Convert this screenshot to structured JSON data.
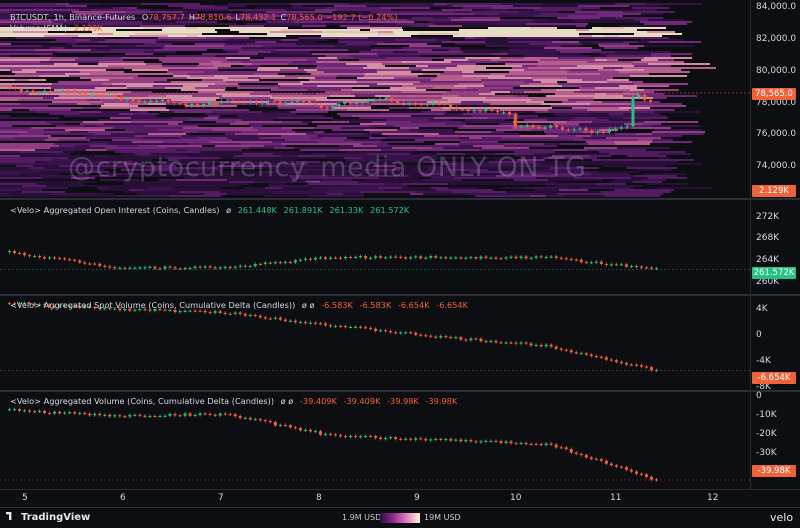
{
  "header": {
    "symbol": "BTCUSDT, 1h, Binance-Futures",
    "ohlc": [
      {
        "k": "O",
        "v": "78,757.7"
      },
      {
        "k": "H",
        "v": "78,810.6"
      },
      {
        "k": "L",
        "v": "78,432.1"
      },
      {
        "k": "C",
        "v": "78,565.0"
      }
    ],
    "change": "−192.7 (−0.24%)",
    "volume_label": "Volume (SMA)",
    "volume_value": "2.129K"
  },
  "watermark": "@cryptocurrency_media ONLY ON TG",
  "price_axis": {
    "ticks": [
      "84,000.0",
      "82,000.0",
      "80,000.0",
      "78,000.0",
      "76,000.0",
      "74,000.0"
    ],
    "current_price": "78,565.0",
    "volume_tag": "2.129K",
    "current_color": "#f0623a"
  },
  "panes": [
    {
      "title": "<Velo> Aggregated Open Interest (Coins, Candles)",
      "symbol": "ø",
      "values": [
        {
          "v": "261.448K",
          "c": "g"
        },
        {
          "v": "261.891K",
          "c": "g"
        },
        {
          "v": "261.33K",
          "c": "g"
        },
        {
          "v": "261.572K",
          "c": "g"
        }
      ],
      "ticks": [
        "272K",
        "268K",
        "264K",
        "260K"
      ],
      "tag": "261.572K",
      "tag_color": "#26c281"
    },
    {
      "title": "<Velo> Aggregated Spot Volume (Coins, Cumulative Delta (Candles))",
      "symbol": "ø ø",
      "values": [
        {
          "v": "-6.583K",
          "c": "r"
        },
        {
          "v": "-6.583K",
          "c": "r"
        },
        {
          "v": "-6.654K",
          "c": "r"
        },
        {
          "v": "-6.654K",
          "c": "r"
        }
      ],
      "ticks": [
        "4K",
        "0",
        "-4K",
        "-8K"
      ],
      "tag": "-6.654K",
      "tag_color": "#f0623a"
    },
    {
      "title": "<Velo> Aggregated Volume (Coins, Cumulative Delta (Candles))",
      "symbol": "ø ø",
      "values": [
        {
          "v": "-39.409K",
          "c": "r"
        },
        {
          "v": "-39.409K",
          "c": "r"
        },
        {
          "v": "-39.98K",
          "c": "r"
        },
        {
          "v": "-39.98K",
          "c": "r"
        }
      ],
      "ticks": [
        "0",
        "-10K",
        "-20K",
        "-30K",
        "-40K"
      ],
      "tag": "-39.98K",
      "tag_color": "#f0623a"
    }
  ],
  "x_axis": [
    "5",
    "6",
    "7",
    "8",
    "9",
    "10",
    "11",
    "12"
  ],
  "footer": {
    "brand": "TradingView",
    "gradient_min": "1.9M USD",
    "gradient_max": "19M USD",
    "velo": "velo"
  },
  "colors": {
    "up": "#26c281",
    "down": "#f0623a",
    "heat_low": "#2a0f3a",
    "heat_high": "#fff4d8"
  },
  "chart_data": [
    {
      "type": "line",
      "title": "Aggregated Open Interest (Coins, Candles)",
      "x": [
        "5",
        "6",
        "7",
        "8",
        "9",
        "10",
        "11"
      ],
      "values": [
        265.0,
        262.0,
        262.0,
        264.0,
        264.0,
        264.0,
        261.6
      ],
      "ylim": [
        258,
        274
      ]
    },
    {
      "type": "line",
      "title": "Aggregated Spot Volume (Coins, Cumulative Delta (Candles))",
      "x": [
        "5",
        "6",
        "7",
        "8",
        "9",
        "10",
        "11"
      ],
      "values": [
        4.8,
        3.8,
        3.2,
        1.0,
        -1.0,
        -2.5,
        -6.7
      ],
      "ylim": [
        -9,
        5
      ]
    },
    {
      "type": "line",
      "title": "Aggregated Volume (Coins, Cumulative Delta (Candles))",
      "x": [
        "5",
        "6",
        "7",
        "8",
        "9",
        "10",
        "11"
      ],
      "values": [
        -5,
        -8,
        -7,
        -18,
        -20,
        -22,
        -40
      ],
      "ylim": [
        -42,
        1
      ]
    }
  ]
}
